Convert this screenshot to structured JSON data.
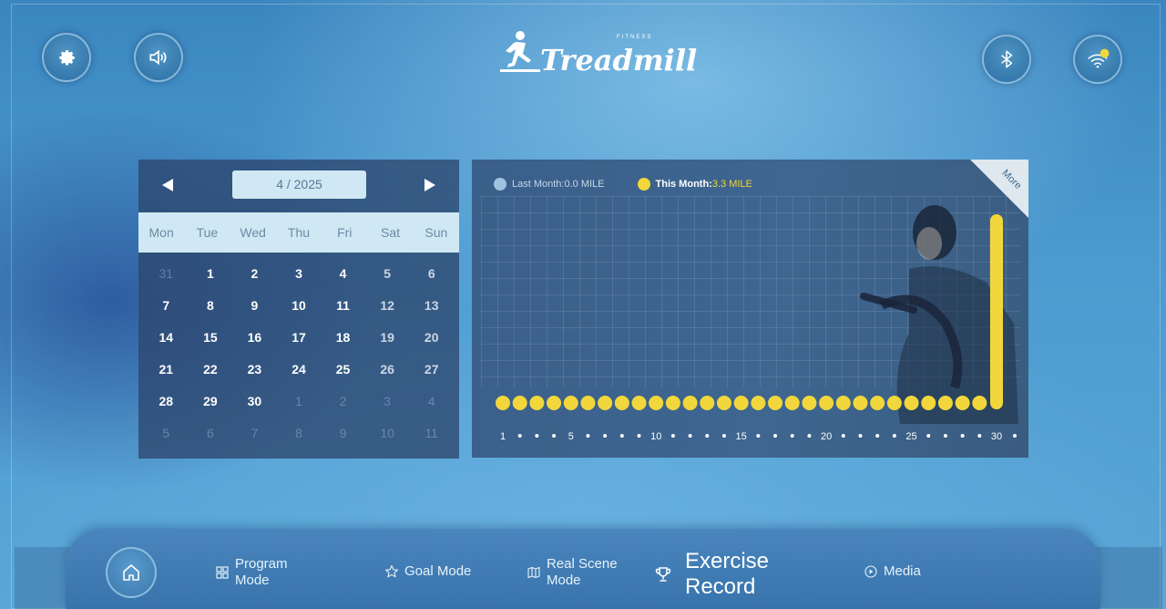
{
  "header": {
    "logo_text": "Treadmill",
    "logo_sub": "FITNESS",
    "icons": {
      "settings": "gear-icon",
      "sound": "speaker-icon",
      "bluetooth": "bluetooth-icon",
      "wifi": "wifi-icon"
    }
  },
  "calendar": {
    "month_label": "4 / 2025",
    "weekdays": [
      "Mon",
      "Tue",
      "Wed",
      "Thu",
      "Fri",
      "Sat",
      "Sun"
    ],
    "days": [
      {
        "d": "31",
        "cur": false
      },
      {
        "d": "1",
        "cur": true
      },
      {
        "d": "2",
        "cur": true
      },
      {
        "d": "3",
        "cur": true
      },
      {
        "d": "4",
        "cur": true
      },
      {
        "d": "5",
        "cur": true
      },
      {
        "d": "6",
        "cur": true
      },
      {
        "d": "7",
        "cur": true
      },
      {
        "d": "8",
        "cur": true
      },
      {
        "d": "9",
        "cur": true
      },
      {
        "d": "10",
        "cur": true
      },
      {
        "d": "11",
        "cur": true
      },
      {
        "d": "12",
        "cur": true
      },
      {
        "d": "13",
        "cur": true
      },
      {
        "d": "14",
        "cur": true
      },
      {
        "d": "15",
        "cur": true
      },
      {
        "d": "16",
        "cur": true
      },
      {
        "d": "17",
        "cur": true
      },
      {
        "d": "18",
        "cur": true
      },
      {
        "d": "19",
        "cur": true
      },
      {
        "d": "20",
        "cur": true
      },
      {
        "d": "21",
        "cur": true
      },
      {
        "d": "22",
        "cur": true
      },
      {
        "d": "23",
        "cur": true
      },
      {
        "d": "24",
        "cur": true
      },
      {
        "d": "25",
        "cur": true
      },
      {
        "d": "26",
        "cur": true
      },
      {
        "d": "27",
        "cur": true
      },
      {
        "d": "28",
        "cur": true
      },
      {
        "d": "29",
        "cur": true
      },
      {
        "d": "30",
        "cur": true
      },
      {
        "d": "1",
        "cur": false
      },
      {
        "d": "2",
        "cur": false
      },
      {
        "d": "3",
        "cur": false
      },
      {
        "d": "4",
        "cur": false
      },
      {
        "d": "5",
        "cur": false
      },
      {
        "d": "6",
        "cur": false
      },
      {
        "d": "7",
        "cur": false
      },
      {
        "d": "8",
        "cur": false
      },
      {
        "d": "9",
        "cur": false
      },
      {
        "d": "10",
        "cur": false
      },
      {
        "d": "11",
        "cur": false
      }
    ]
  },
  "chart_panel": {
    "legend_last_label": "Last Month:",
    "legend_last_value": "0.0 MILE",
    "legend_this_label": "This Month:",
    "legend_this_value": "3.3 MILE",
    "more_label": "More"
  },
  "chart_data": {
    "type": "bar",
    "x": [
      1,
      2,
      3,
      4,
      5,
      6,
      7,
      8,
      9,
      10,
      11,
      12,
      13,
      14,
      15,
      16,
      17,
      18,
      19,
      20,
      21,
      22,
      23,
      24,
      25,
      26,
      27,
      28,
      29,
      30
    ],
    "tick_labels": [
      "1",
      "5",
      "10",
      "15",
      "20",
      "25",
      "30"
    ],
    "series": [
      {
        "name": "This Month",
        "color": "#f1d73b",
        "values": [
          0,
          0,
          0,
          0,
          0,
          0,
          0,
          0,
          0,
          0,
          0,
          0,
          0,
          0,
          0,
          0,
          0,
          0,
          0,
          0,
          0,
          0,
          0,
          0,
          0,
          0,
          0,
          0,
          0,
          3.3
        ]
      }
    ],
    "grid": true
  },
  "nav": {
    "home_icon": "home-icon",
    "program_line1": "Program",
    "program_line2": "Mode",
    "goal": "Goal Mode",
    "realscene_line1": "Real Scene",
    "realscene_line2": "Mode",
    "exercise_line1": "Exercise",
    "exercise_line2": "Record",
    "media": "Media"
  },
  "colors": {
    "accent_yellow": "#f1d73b",
    "last_month_dot": "#9fc3dc",
    "calendar_header": "#cfe8f4"
  }
}
